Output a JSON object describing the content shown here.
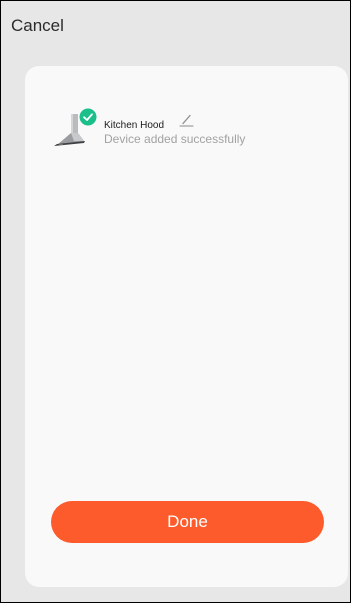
{
  "header": {
    "cancel_label": "Cancel"
  },
  "device": {
    "name": "Kitchen Hood",
    "status": "Device added successfully",
    "thumbnail_icon": "range-hood-icon",
    "badge_icon": "check-circle-icon",
    "edit_icon": "pencil-icon"
  },
  "actions": {
    "done_label": "Done"
  },
  "colors": {
    "accent": "#fd5b2b",
    "success": "#1bbf8a",
    "background": "#e7e7e7",
    "card": "#f9f9f9",
    "secondary_text": "#a2a2a2"
  }
}
